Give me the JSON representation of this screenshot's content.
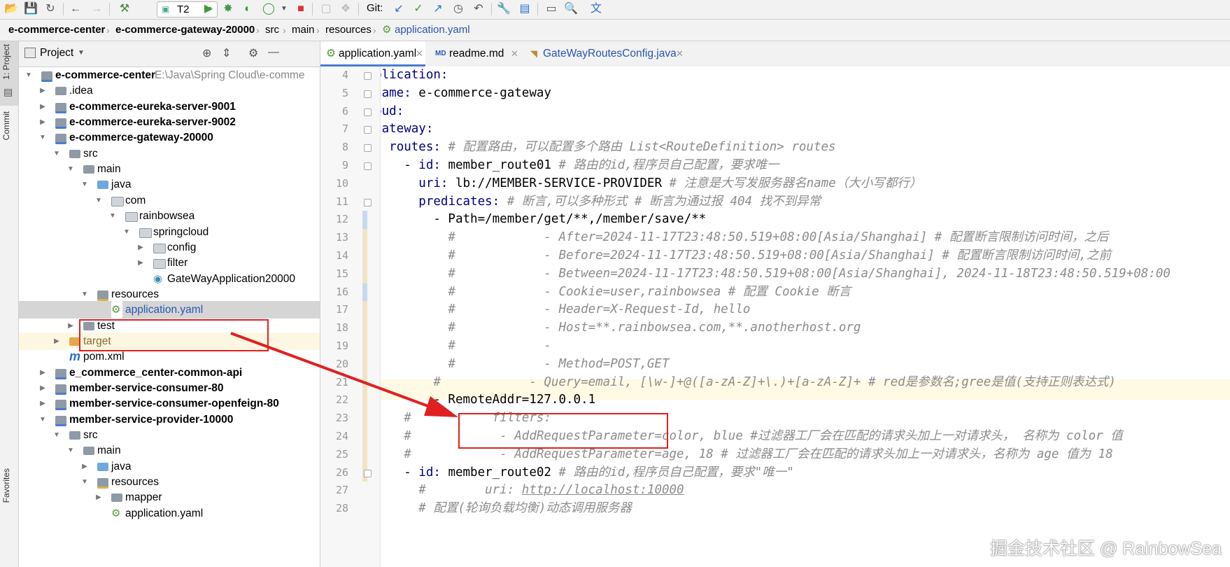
{
  "toolbar": {
    "run_config": "T2",
    "git_label": "Git:",
    "icons": [
      "open-folder-icon",
      "save-icon",
      "sync-icon",
      "back-icon",
      "forward-icon",
      "build-hammer-icon",
      "run-icon",
      "debug-icon",
      "coverage-icon",
      "profile-icon",
      "stop-icon",
      "git-update-icon",
      "git-commit-icon",
      "git-push-icon",
      "history-icon",
      "rollback-icon",
      "settings-icon",
      "project-structure-icon",
      "terminal-icon",
      "search-icon",
      "translate-icon"
    ]
  },
  "breadcrumb": [
    "e-commerce-center",
    "e-commerce-gateway-20000",
    "src",
    "main",
    "resources",
    "application.yaml"
  ],
  "left_strip": {
    "project_tab": "1: Project",
    "commit_tab": "Commit",
    "favorites_tab": "Favorites"
  },
  "project_panel": {
    "title": "Project",
    "tree": [
      {
        "label": "e-commerce-center",
        "hint": "E:\\Java\\Spring Cloud\\e-comme",
        "kind": "module"
      },
      {
        "label": ".idea",
        "kind": "folder"
      },
      {
        "label": "e-commerce-eureka-server-9001",
        "kind": "module"
      },
      {
        "label": "e-commerce-eureka-server-9002",
        "kind": "module"
      },
      {
        "label": "e-commerce-gateway-20000",
        "kind": "module"
      },
      {
        "label": "src",
        "kind": "folder"
      },
      {
        "label": "main",
        "kind": "folder"
      },
      {
        "label": "java",
        "kind": "src"
      },
      {
        "label": "com",
        "kind": "pkg"
      },
      {
        "label": "rainbowsea",
        "kind": "pkg"
      },
      {
        "label": "springcloud",
        "kind": "pkg"
      },
      {
        "label": "config",
        "kind": "pkg"
      },
      {
        "label": "filter",
        "kind": "pkg"
      },
      {
        "label": "GateWayApplication20000",
        "kind": "class"
      },
      {
        "label": "resources",
        "kind": "res"
      },
      {
        "label": "application.yaml",
        "kind": "yaml"
      },
      {
        "label": "test",
        "kind": "folder"
      },
      {
        "label": "target",
        "kind": "target"
      },
      {
        "label": "pom.xml",
        "kind": "maven"
      },
      {
        "label": "e_commerce_center-common-api",
        "kind": "module"
      },
      {
        "label": "member-service-consumer-80",
        "kind": "module"
      },
      {
        "label": "member-service-consumer-openfeign-80",
        "kind": "module"
      },
      {
        "label": "member-service-provider-10000",
        "kind": "module"
      },
      {
        "label": "src",
        "kind": "folder"
      },
      {
        "label": "main",
        "kind": "folder"
      },
      {
        "label": "java",
        "kind": "src"
      },
      {
        "label": "resources",
        "kind": "res"
      },
      {
        "label": "mapper",
        "kind": "folder"
      },
      {
        "label": "application.yaml",
        "kind": "yaml"
      }
    ]
  },
  "editor": {
    "tabs": [
      "application.yaml",
      "readme.md",
      "GateWayRoutesConfig.java"
    ],
    "line_numbers": [
      "4",
      "5",
      "6",
      "7",
      "8",
      "9",
      "10",
      "11",
      "12",
      "13",
      "14",
      "15",
      "16",
      "17",
      "18",
      "19",
      "20",
      "21",
      "22",
      "23",
      "24",
      "25",
      "26",
      "27",
      "28"
    ],
    "lines": [
      [
        [
          "k",
          "application:"
        ]
      ],
      [
        [
          "v",
          "  "
        ],
        [
          "k",
          "name:"
        ],
        [
          "v",
          " e-commerce-gateway"
        ]
      ],
      [
        [
          "k",
          "cloud:"
        ]
      ],
      [
        [
          "v",
          "  "
        ],
        [
          "k",
          "gateway:"
        ]
      ],
      [
        [
          "v",
          "    "
        ],
        [
          "k",
          "routes:"
        ],
        [
          "c",
          " # 配置路由，可以配置多个路由 List<RouteDefinition> routes"
        ]
      ],
      [
        [
          "v",
          "      - "
        ],
        [
          "k",
          "id:"
        ],
        [
          "v",
          " member_route01"
        ],
        [
          "c",
          " # 路由的id,程序员自己配置，要求唯一"
        ]
      ],
      [
        [
          "v",
          "        "
        ],
        [
          "k",
          "uri:"
        ],
        [
          "v",
          " lb://MEMBER-SERVICE-PROVIDER"
        ],
        [
          "c",
          " # 注意是大写发服务器名name（大小写都行）"
        ]
      ],
      [
        [
          "v",
          "        "
        ],
        [
          "k",
          "predicates:"
        ],
        [
          "c",
          " # 断言,可以多种形式 # 断言为通过报 404 找不到异常"
        ]
      ],
      [
        [
          "v",
          "          - Path=/member/get/**,/member/save/**"
        ]
      ],
      [
        [
          "c",
          "            #            - After=2024-11-17T23:48:50.519+08:00[Asia/Shanghai] # 配置断言限制访问时间，之后"
        ]
      ],
      [
        [
          "c",
          "            #            - Before=2024-11-17T23:48:50.519+08:00[Asia/Shanghai] # 配置断言限制访问时间,之前"
        ]
      ],
      [
        [
          "c",
          "            #            - Between=2024-11-17T23:48:50.519+08:00[Asia/Shanghai], 2024-11-18T23:48:50.519+08:00"
        ]
      ],
      [
        [
          "c",
          "            #            - Cookie=user,rainbowsea # 配置 Cookie 断言"
        ]
      ],
      [
        [
          "c",
          "            #            - Header=X-Request-Id, hello"
        ]
      ],
      [
        [
          "c",
          "            #            - Host=**.rainbowsea.com,**.anotherhost.org"
        ]
      ],
      [
        [
          "c",
          "            #            -"
        ]
      ],
      [
        [
          "c",
          "            #            - Method=POST,GET"
        ]
      ],
      [
        [
          "c",
          "          #            - Query=email, [\\w-]+@([a-zA-Z]+\\.)+[a-zA-Z]+ # red是参数名;gree是值(支持正则表达式)"
        ]
      ],
      [
        [
          "v",
          "          - RemoteAddr=127.0.0.1"
        ]
      ],
      [
        [
          "c",
          "      #           filters:"
        ]
      ],
      [
        [
          "c",
          "      #            - AddRequestParameter=color, blue #过滤器工厂会在匹配的请求头加上一对请求头， 名称为 color 值"
        ]
      ],
      [
        [
          "c",
          "      #            - AddRequestParameter=age, 18 # 过滤器工厂会在匹配的请求头加上一对请求头，名称为 age 值为 18"
        ]
      ],
      [
        [
          "v",
          "      - "
        ],
        [
          "k",
          "id:"
        ],
        [
          "v",
          " member_route02"
        ],
        [
          "c",
          " # 路由的id,程序员自己配置，要求\"唯一\""
        ]
      ],
      [
        [
          "c",
          "        #        uri: "
        ],
        [
          "u",
          "http://localhost:10000"
        ]
      ],
      [
        [
          "c",
          "        # 配置(轮询负载均衡)动态调用服务器"
        ]
      ]
    ]
  },
  "watermark": "掘金技术社区 @ RainbowSea",
  "colors": {
    "annotation_red": "#e02020",
    "keyword": "#000080",
    "comment": "#8c8c8c",
    "folder": "#8e9aa6",
    "source_folder": "#6fa8dc"
  }
}
